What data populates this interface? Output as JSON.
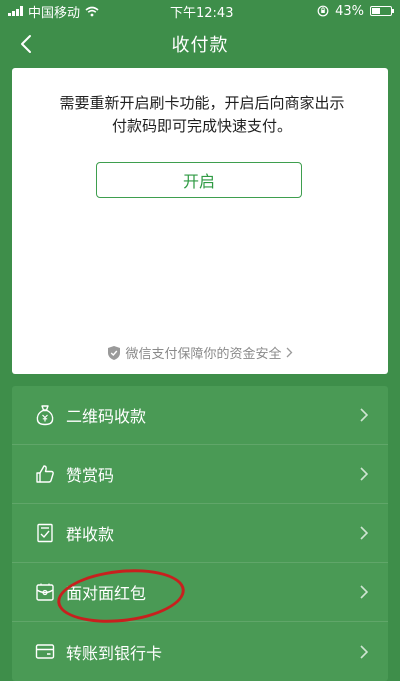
{
  "status_bar": {
    "carrier": "中国移动",
    "time": "下午12:43",
    "battery_percent": "43%",
    "battery_level": 0.43
  },
  "nav": {
    "title": "收付款",
    "back_icon": "chevron-left-icon"
  },
  "card": {
    "message": "需要重新开启刷卡功能，开启后向商家出示付款码即可完成快速支付。",
    "open_button_label": "开启",
    "guarantee_text": "微信支付保障你的资金安全",
    "guarantee_icon": "shield-icon"
  },
  "menu": {
    "items": [
      {
        "label": "二维码收款",
        "icon": "money-bag-icon"
      },
      {
        "label": "赞赏码",
        "icon": "thumbs-up-icon"
      },
      {
        "label": "群收款",
        "icon": "group-receipt-icon"
      },
      {
        "label": "面对面红包",
        "icon": "red-packet-icon"
      },
      {
        "label": "转账到银行卡",
        "icon": "bank-card-icon"
      }
    ]
  },
  "colors": {
    "background": "#3e8e4a",
    "menu_background": "#4a9a55",
    "accent_green": "#2f9a43",
    "annotation_red": "#c8201e"
  }
}
